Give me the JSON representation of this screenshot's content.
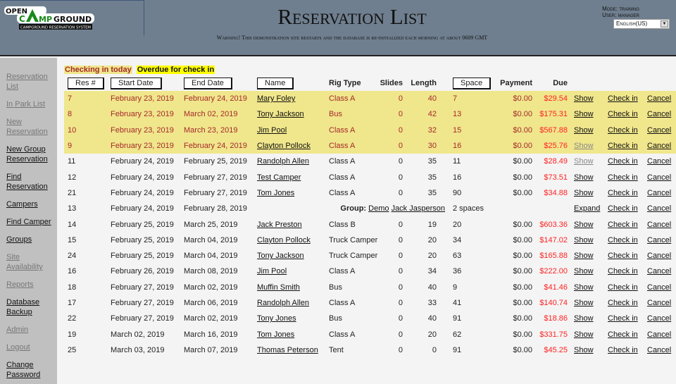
{
  "header": {
    "logo_text": "OPEN CAMPGROUND",
    "logo_sub": "CAMPGROUND RESERVATION SYSTEM",
    "title": "Reservation List",
    "warning": "Warning! This demonstration site restarts and the database is re-initialized each morning at about 0609 GMT",
    "mode": "Mode: training",
    "user": "User: manager",
    "language": "English(US)"
  },
  "sidebar": [
    {
      "label": "Reservation List",
      "enabled": false
    },
    {
      "label": "In Park List",
      "enabled": false
    },
    {
      "label": "New Reservation",
      "enabled": false
    },
    {
      "label": "New Group Reservation",
      "enabled": true
    },
    {
      "label": "Find Reservation",
      "enabled": true
    },
    {
      "label": "Campers",
      "enabled": true
    },
    {
      "label": "Find Camper",
      "enabled": true
    },
    {
      "label": "Groups",
      "enabled": true
    },
    {
      "label": "Site Availability",
      "enabled": false
    },
    {
      "label": "Reports",
      "enabled": false
    },
    {
      "label": "Database Backup",
      "enabled": true
    },
    {
      "label": "Admin",
      "enabled": false
    },
    {
      "label": "Logout",
      "enabled": false
    },
    {
      "label": "Change Password",
      "enabled": true
    }
  ],
  "legend": {
    "today": "Checking in today",
    "overdue": "Overdue for check in"
  },
  "columns": {
    "res": "Res #",
    "start": "Start Date",
    "end": "End Date",
    "name": "Name",
    "rig": "Rig Type",
    "slides": "Slides",
    "length": "Length",
    "space": "Space",
    "payment": "Payment",
    "due": "Due"
  },
  "actions": {
    "show": "Show",
    "checkin": "Check in",
    "cancel": "Cancel",
    "expand": "Expand"
  },
  "group_row": {
    "res": "13",
    "start": "February 24, 2019",
    "end": "February 28, 2019",
    "group_label": "Group:",
    "group_name": "Demo",
    "contact": "Jack Jasperson",
    "spaces": "2 spaces"
  },
  "rows": [
    {
      "res": "7",
      "start": "February 23, 2019",
      "end": "February 24, 2019",
      "name": "Mary Foley",
      "rig": "Class A",
      "slides": "0",
      "length": "40",
      "space": "7",
      "payment": "$0.00",
      "due": "$29.54",
      "today": true,
      "show_enabled": true
    },
    {
      "res": "8",
      "start": "February 23, 2019",
      "end": "March 02, 2019",
      "name": "Tony Jackson",
      "rig": "Bus",
      "slides": "0",
      "length": "42",
      "space": "13",
      "payment": "$0.00",
      "due": "$175.31",
      "today": true,
      "show_enabled": true
    },
    {
      "res": "10",
      "start": "February 23, 2019",
      "end": "March 23, 2019",
      "name": "Jim Pool",
      "rig": "Class A",
      "slides": "0",
      "length": "32",
      "space": "15",
      "payment": "$0.00",
      "due": "$567.88",
      "today": true,
      "show_enabled": true
    },
    {
      "res": "9",
      "start": "February 23, 2019",
      "end": "February 24, 2019",
      "name": "Clayton Pollock",
      "rig": "Class A",
      "slides": "0",
      "length": "30",
      "space": "16",
      "payment": "$0.00",
      "due": "$25.76",
      "today": true,
      "show_enabled": false
    },
    {
      "res": "11",
      "start": "February 24, 2019",
      "end": "February 25, 2019",
      "name": "Randolph Allen",
      "rig": "Class A",
      "slides": "0",
      "length": "35",
      "space": "11",
      "payment": "$0.00",
      "due": "$28.49",
      "today": false,
      "show_enabled": false
    },
    {
      "res": "12",
      "start": "February 24, 2019",
      "end": "February 27, 2019",
      "name": "Test Camper",
      "rig": "Class A",
      "slides": "0",
      "length": "35",
      "space": "16",
      "payment": "$0.00",
      "due": "$73.51",
      "today": false,
      "show_enabled": true
    },
    {
      "res": "21",
      "start": "February 24, 2019",
      "end": "February 27, 2019",
      "name": "Tom Jones",
      "rig": "Class A",
      "slides": "0",
      "length": "35",
      "space": "90",
      "payment": "$0.00",
      "due": "$34.88",
      "today": false,
      "show_enabled": true
    },
    {
      "group": true
    },
    {
      "res": "14",
      "start": "February 25, 2019",
      "end": "March 25, 2019",
      "name": "Jack Preston",
      "rig": "Class B",
      "slides": "0",
      "length": "19",
      "space": "20",
      "payment": "$0.00",
      "due": "$603.36",
      "today": false,
      "show_enabled": true
    },
    {
      "res": "15",
      "start": "February 25, 2019",
      "end": "March 04, 2019",
      "name": "Clayton Pollock",
      "rig": "Truck Camper",
      "slides": "0",
      "length": "20",
      "space": "34",
      "payment": "$0.00",
      "due": "$147.02",
      "today": false,
      "show_enabled": true
    },
    {
      "res": "24",
      "start": "February 25, 2019",
      "end": "March 04, 2019",
      "name": "Tony Jackson",
      "rig": "Truck Camper",
      "slides": "0",
      "length": "20",
      "space": "63",
      "payment": "$0.00",
      "due": "$165.88",
      "today": false,
      "show_enabled": true
    },
    {
      "res": "16",
      "start": "February 26, 2019",
      "end": "March 08, 2019",
      "name": "Jim Pool",
      "rig": "Class A",
      "slides": "0",
      "length": "34",
      "space": "36",
      "payment": "$0.00",
      "due": "$222.00",
      "today": false,
      "show_enabled": true
    },
    {
      "res": "18",
      "start": "February 27, 2019",
      "end": "March 02, 2019",
      "name": "Muffin Smith",
      "rig": "Bus",
      "slides": "0",
      "length": "40",
      "space": "9",
      "payment": "$0.00",
      "due": "$41.46",
      "today": false,
      "show_enabled": true
    },
    {
      "res": "17",
      "start": "February 27, 2019",
      "end": "March 06, 2019",
      "name": "Randolph Allen",
      "rig": "Class A",
      "slides": "0",
      "length": "33",
      "space": "41",
      "payment": "$0.00",
      "due": "$140.74",
      "today": false,
      "show_enabled": true
    },
    {
      "res": "22",
      "start": "February 27, 2019",
      "end": "March 02, 2019",
      "name": "Tony Jones",
      "rig": "Bus",
      "slides": "0",
      "length": "40",
      "space": "91",
      "payment": "$0.00",
      "due": "$18.86",
      "today": false,
      "show_enabled": true
    },
    {
      "res": "19",
      "start": "March 02, 2019",
      "end": "March 16, 2019",
      "name": "Tom Jones",
      "rig": "Class A",
      "slides": "0",
      "length": "20",
      "space": "62",
      "payment": "$0.00",
      "due": "$331.75",
      "today": false,
      "show_enabled": true
    },
    {
      "res": "25",
      "start": "March 03, 2019",
      "end": "March 07, 2019",
      "name": "Thomas Peterson",
      "rig": "Tent",
      "slides": "0",
      "length": "0",
      "space": "91",
      "payment": "$0.00",
      "due": "$45.25",
      "today": false,
      "show_enabled": true
    }
  ]
}
